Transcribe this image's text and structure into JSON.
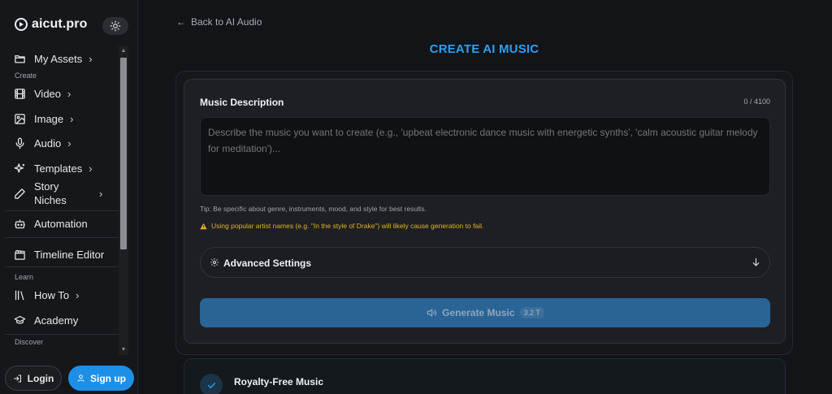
{
  "brand": {
    "name": "aicut.pro"
  },
  "sidebar": {
    "items": [
      {
        "key": "my-assets",
        "label": "My Assets",
        "icon": "folder-icon",
        "chevron": true
      },
      {
        "key": "video",
        "label": "Video",
        "icon": "film-icon",
        "chevron": true
      },
      {
        "key": "image",
        "label": "Image",
        "icon": "image-icon",
        "chevron": true
      },
      {
        "key": "audio",
        "label": "Audio",
        "icon": "microphone-icon",
        "chevron": true
      },
      {
        "key": "templates",
        "label": "Templates",
        "icon": "sparkles-icon",
        "chevron": true
      },
      {
        "key": "story-niches",
        "label": "Story Niches",
        "icon": "pencil-icon",
        "chevron": true
      },
      {
        "key": "automation",
        "label": "Automation",
        "icon": "robot-icon",
        "chevron": false
      },
      {
        "key": "timeline-editor",
        "label": "Timeline Editor",
        "icon": "clapperboard-icon",
        "chevron": false
      },
      {
        "key": "how-to",
        "label": "How To",
        "icon": "library-icon",
        "chevron": true
      },
      {
        "key": "academy",
        "label": "Academy",
        "icon": "graduation-cap-icon",
        "chevron": false
      }
    ],
    "sections": {
      "create": "Create",
      "learn": "Learn",
      "discover": "Discover"
    },
    "login_label": "Login",
    "signup_label": "Sign up"
  },
  "main": {
    "back_label": "Back to AI Audio",
    "title": "CREATE AI MUSIC",
    "description_label": "Music Description",
    "char_count": "0 / 4100",
    "placeholder": "Describe the music you want to create (e.g., 'upbeat electronic dance music with energetic synths', 'calm acoustic guitar melody for meditation')...",
    "tip": "Tip: Be specific about genre, instruments, mood, and style for best results.",
    "warning": "Using popular artist names (e.g. \"In the style of Drake\") will likely cause generation to fail.",
    "advanced_label": "Advanced Settings",
    "generate_label": "Generate Music",
    "generate_cost": "3.2 T",
    "feature_title": "Royalty-Free Music"
  },
  "colors": {
    "accent": "#1e8fe6",
    "title": "#2ea0f0",
    "warning": "#e2b12a",
    "generate_bg": "#2a6496"
  }
}
